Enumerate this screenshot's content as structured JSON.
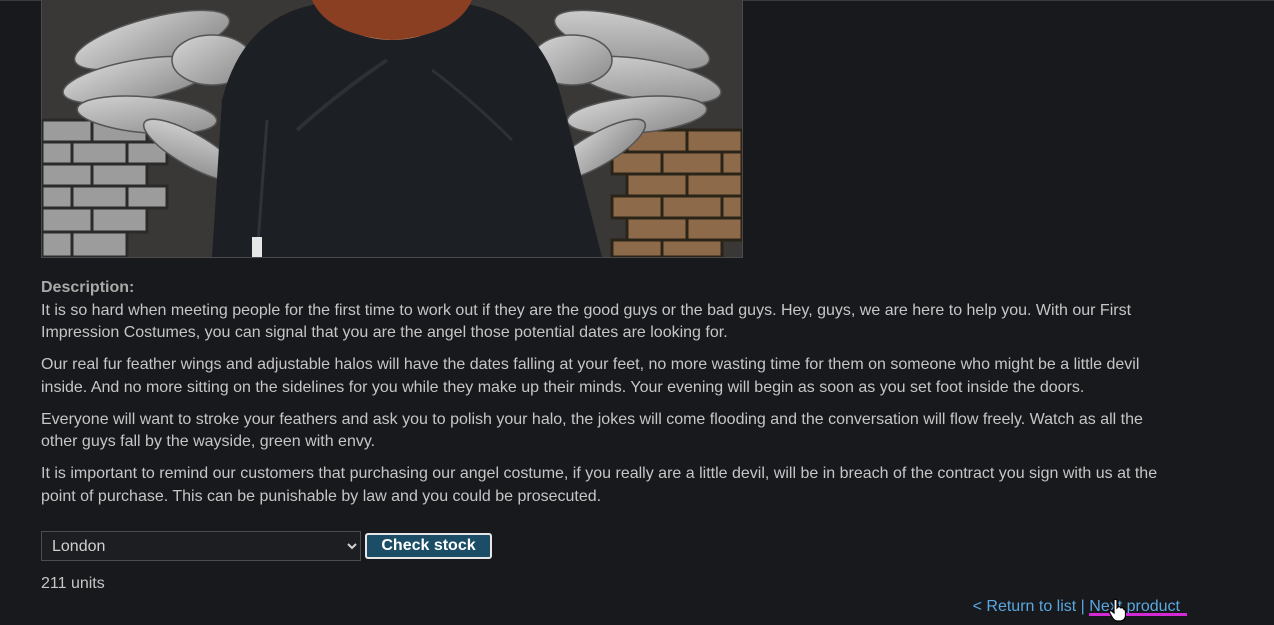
{
  "product": {
    "image_alt_icon": "product-photo",
    "description_label": "Description:",
    "description_paragraphs": [
      "It is so hard when meeting people for the first time to work out if they are the good guys or the bad guys. Hey, guys, we are here to help you. With our First Impression Costumes, you can signal that you are the angel those potential dates are looking for.",
      "Our real fur feather wings and adjustable halos will have the dates falling at your feet, no more wasting time for them on someone who might be a little devil inside. And no more sitting on the sidelines for you while they make up their minds. Your evening will begin as soon as you set foot inside the doors.",
      "Everyone will want to stroke your feathers and ask you to polish your halo, the jokes will come flooding and the conversation will flow freely. Watch as all the other guys fall by the wayside, green with envy.",
      "It is important to remind our customers that purchasing our angel costume, if you really are a little devil, will be in breach of the contract you sign with us at the point of purchase. This can be punishable by law and you could be prosecuted."
    ]
  },
  "stock": {
    "selected_store": "London",
    "check_label": "Check stock",
    "result": "211 units"
  },
  "footer": {
    "return_label": "< Return to list",
    "separator": "|",
    "next_label": "Next product"
  },
  "colors": {
    "background": "#18191c",
    "link": "#5aa7e0",
    "button": "#1b4d66",
    "highlight": "#d42ad6"
  }
}
